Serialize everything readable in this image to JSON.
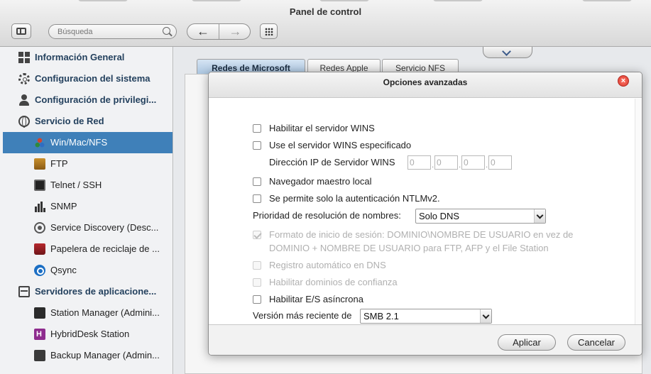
{
  "window": {
    "title": "Panel de control"
  },
  "toolbar": {
    "search_placeholder": "Búsqueda",
    "back_glyph": "←",
    "forward_glyph": "→"
  },
  "sidebar": {
    "items": [
      {
        "label": "Información General",
        "icon": "info-icon",
        "level": "head"
      },
      {
        "label": "Configuracion del sistema",
        "icon": "gear-icon",
        "level": "head"
      },
      {
        "label": "Configuración de privilegi...",
        "icon": "user-icon",
        "level": "head"
      },
      {
        "label": "Servicio de Red",
        "icon": "globe-icon",
        "level": "head"
      },
      {
        "label": "Win/Mac/NFS",
        "icon": "network-share-icon",
        "level": "sub",
        "active": true
      },
      {
        "label": "FTP",
        "icon": "ftp-icon",
        "level": "sub"
      },
      {
        "label": "Telnet / SSH",
        "icon": "terminal-icon",
        "level": "sub"
      },
      {
        "label": "SNMP",
        "icon": "bar-chart-icon",
        "level": "sub"
      },
      {
        "label": "Service Discovery (Desc...",
        "icon": "discovery-icon",
        "level": "sub"
      },
      {
        "label": "Papelera de reciclaje de ...",
        "icon": "recycle-bin-icon",
        "level": "sub"
      },
      {
        "label": "Qsync",
        "icon": "qsync-icon",
        "level": "sub"
      },
      {
        "label": "Servidores de aplicacione...",
        "icon": "apps-server-icon",
        "level": "head"
      },
      {
        "label": "Station Manager (Admini...",
        "icon": "station-icon",
        "level": "sub"
      },
      {
        "label": "HybridDesk Station",
        "icon": "hybriddesk-icon",
        "level": "sub"
      },
      {
        "label": "Backup Manager (Admin...",
        "icon": "backup-icon",
        "level": "sub"
      }
    ]
  },
  "tabs": [
    {
      "label": "Redes de Microsoft",
      "active": true
    },
    {
      "label": "Redes Apple",
      "active": false
    },
    {
      "label": "Servicio NFS",
      "active": false
    }
  ],
  "modal": {
    "title": "Opciones avanzadas",
    "close_glyph": "×",
    "options": {
      "wins_server": "Habilitar el servidor WINS",
      "use_wins": "Use el servidor WINS especificado",
      "wins_ip_label": "Dirección IP de Servidor WINS",
      "wins_ip": [
        "0",
        "0",
        "0",
        "0"
      ],
      "master_browser": "Navegador maestro local",
      "ntlmv2": "Se permite solo la autenticación NTLMv2.",
      "name_priority_label": "Prioridad de resolución de nombres:",
      "name_priority_value": "Solo DNS",
      "login_format_line1": "Formato de inicio de sesión: DOMINIO\\NOMBRE DE USUARIO en vez de",
      "login_format_line2": "DOMINIO + NOMBRE DE USUARIO para FTP, AFP y el File Station",
      "auto_dns": "Registro automático en DNS",
      "trusted_domains": "Habilitar dominios de confianza",
      "async_io": "Habilitar E/S asíncrona",
      "latest_version_label": "Versión más reciente de",
      "latest_version_value": "SMB 2.1"
    },
    "apply_label": "Aplicar",
    "cancel_label": "Cancelar"
  }
}
